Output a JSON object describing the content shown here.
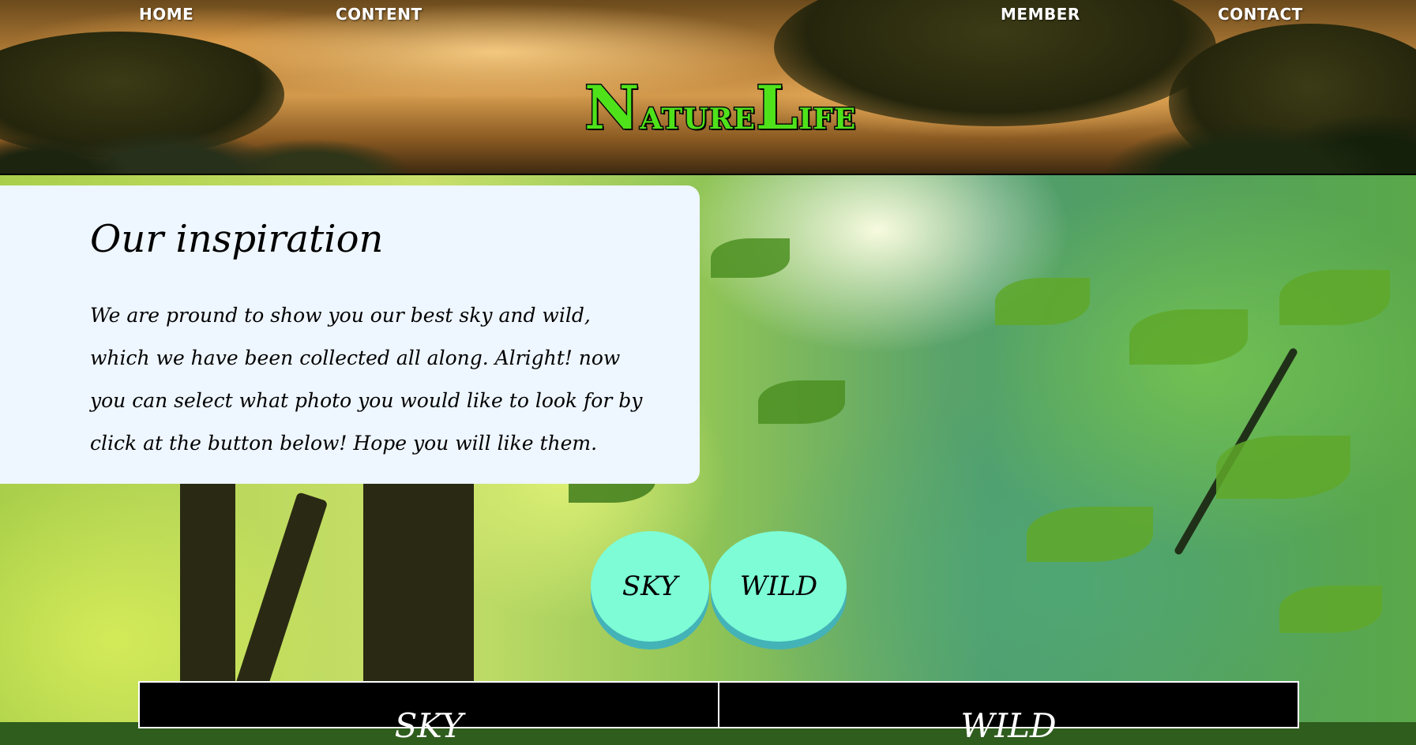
{
  "nav": {
    "home": "HOME",
    "content": "CONTENT",
    "member": "MEMBER",
    "contact": "CONTACT"
  },
  "logo": {
    "first_initial": "N",
    "first_rest": "ature",
    "second_initial": "L",
    "second_rest": "ife"
  },
  "intro": {
    "heading": "Our inspiration",
    "body": "We are pround to show you our best sky and wild, which we have been collected all along. Alright! now you can select what photo you would like to look for by click at the button below! Hope you will like them."
  },
  "buttons": {
    "sky": "SKY",
    "wild": "WILD"
  },
  "panels": {
    "sky_title": "SKY",
    "wild_title": "WILD"
  },
  "colors": {
    "logo_green": "#4fe21a",
    "button_fill": "#7dfcd6",
    "button_shadow": "#44b3b8",
    "card_bg": "#eef6ff"
  }
}
